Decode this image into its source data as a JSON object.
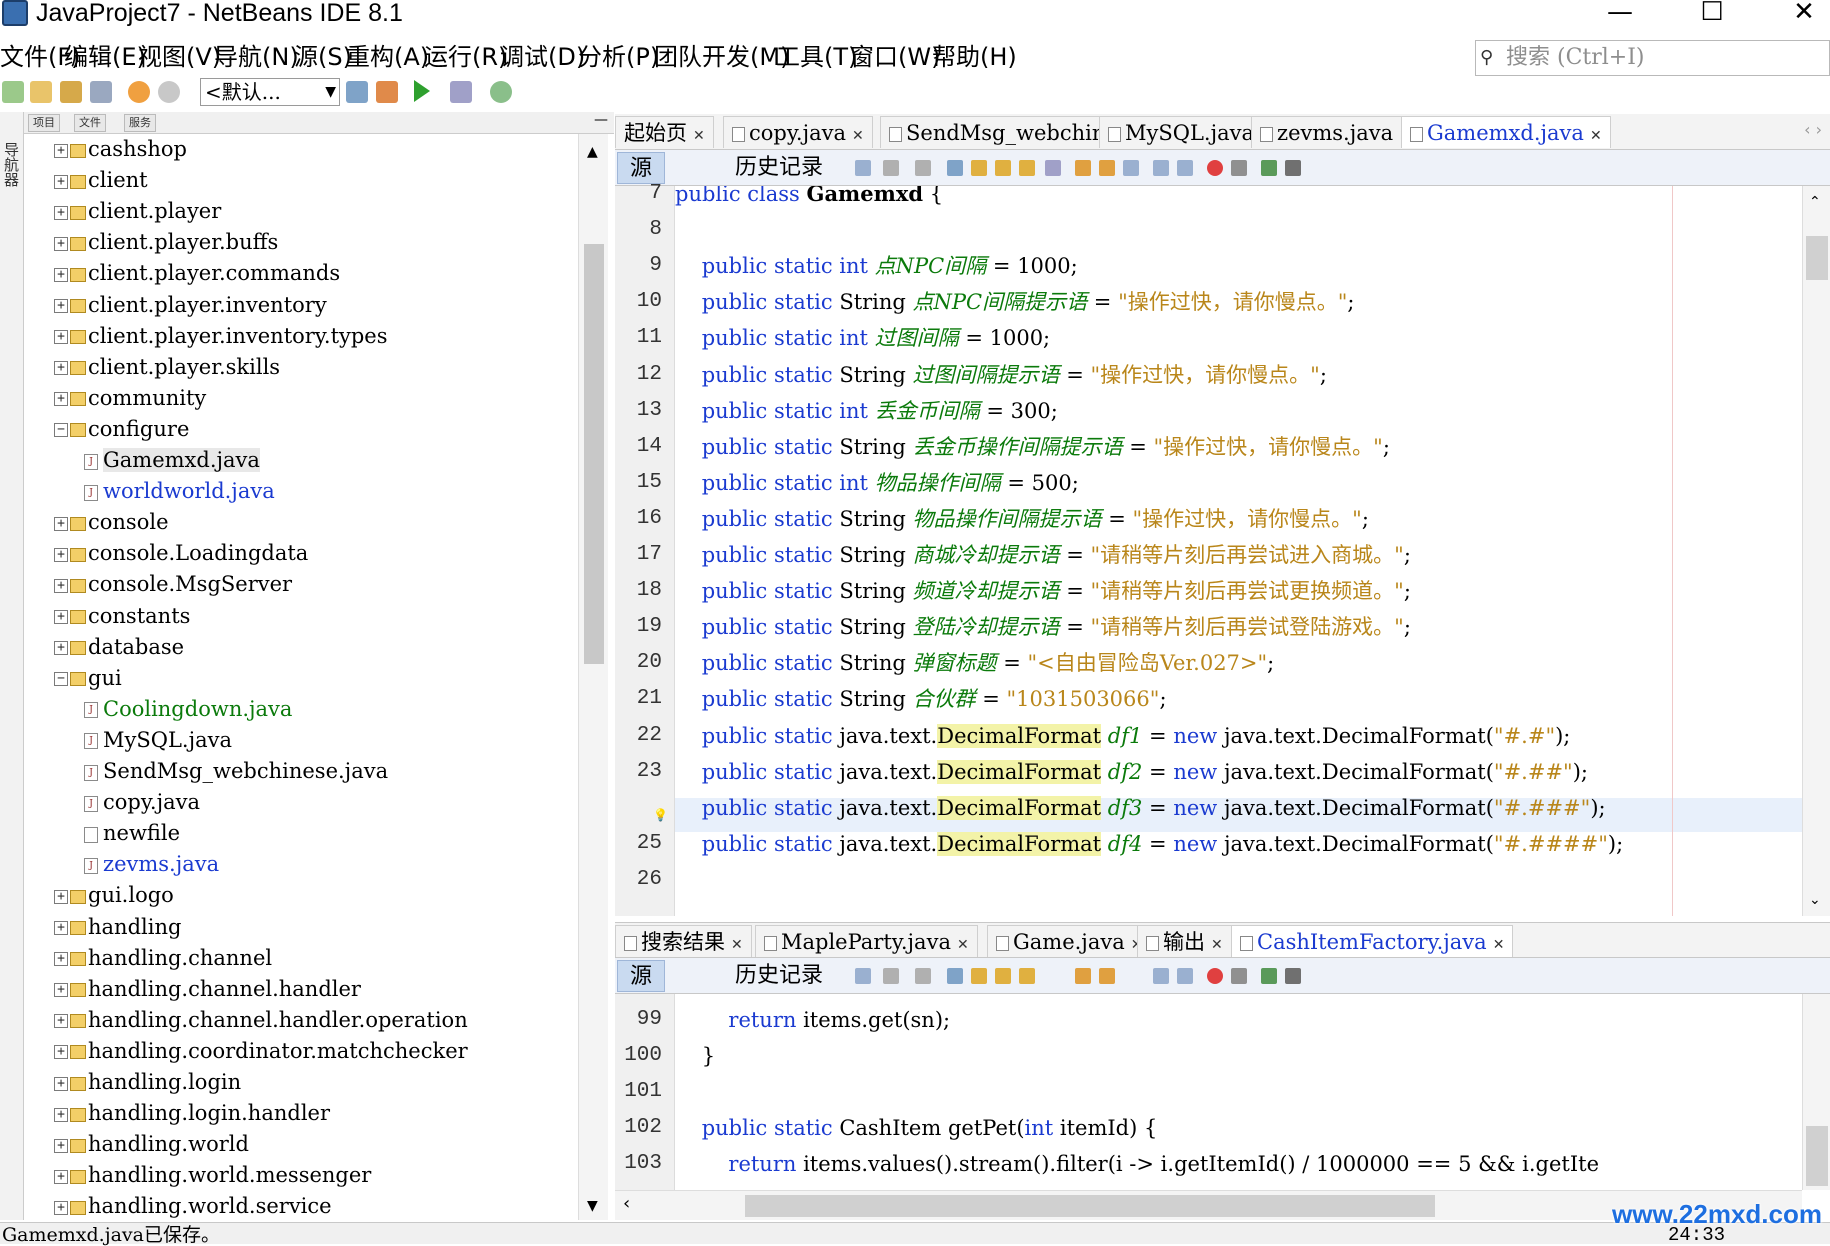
{
  "window": {
    "title": "JavaProject7 - NetBeans IDE 8.1",
    "min": "—",
    "max": "☐",
    "close": "✕"
  },
  "menu": [
    "文件(F)",
    "编辑(E)",
    "视图(V)",
    "导航(N)",
    "源(S)",
    "重构(A)",
    "运行(R)",
    "调试(D)",
    "分析(P)",
    "团队开发(M)",
    "工具(T)",
    "窗口(W)",
    "帮助(H)"
  ],
  "search": {
    "placeholder": "搜索 (Ctrl+I)"
  },
  "toolbar": {
    "config": "<默认..."
  },
  "side": {
    "navigator": "导航器"
  },
  "project_tabs": [
    "项目",
    "文件",
    "服务"
  ],
  "tree": [
    {
      "label": "cashshop",
      "type": "pkg",
      "exp": "+"
    },
    {
      "label": "client",
      "type": "pkg",
      "exp": "+"
    },
    {
      "label": "client.player",
      "type": "pkg",
      "exp": "+"
    },
    {
      "label": "client.player.buffs",
      "type": "pkg",
      "exp": "+"
    },
    {
      "label": "client.player.commands",
      "type": "pkg",
      "exp": "+"
    },
    {
      "label": "client.player.inventory",
      "type": "pkg",
      "exp": "+"
    },
    {
      "label": "client.player.inventory.types",
      "type": "pkg",
      "exp": "+"
    },
    {
      "label": "client.player.skills",
      "type": "pkg",
      "exp": "+"
    },
    {
      "label": "community",
      "type": "pkg",
      "exp": "+"
    },
    {
      "label": "configure",
      "type": "pkg",
      "exp": "−"
    },
    {
      "label": "Gamemxd.java",
      "type": "file",
      "sel": true
    },
    {
      "label": "worldworld.java",
      "type": "file",
      "color": "blue"
    },
    {
      "label": "console",
      "type": "pkg",
      "exp": "+"
    },
    {
      "label": "console.Loadingdata",
      "type": "pkg",
      "exp": "+"
    },
    {
      "label": "console.MsgServer",
      "type": "pkg",
      "exp": "+"
    },
    {
      "label": "constants",
      "type": "pkg",
      "exp": "+"
    },
    {
      "label": "database",
      "type": "pkg",
      "exp": "+"
    },
    {
      "label": "gui",
      "type": "pkg",
      "exp": "−"
    },
    {
      "label": "Coolingdown.java",
      "type": "file",
      "color": "green"
    },
    {
      "label": "MySQL.java",
      "type": "file"
    },
    {
      "label": "SendMsg_webchinese.java",
      "type": "file"
    },
    {
      "label": "copy.java",
      "type": "file"
    },
    {
      "label": "newfile",
      "type": "file"
    },
    {
      "label": "zevms.java",
      "type": "file",
      "color": "blue"
    },
    {
      "label": "gui.logo",
      "type": "pkg",
      "exp": "+"
    },
    {
      "label": "handling",
      "type": "pkg",
      "exp": "+"
    },
    {
      "label": "handling.channel",
      "type": "pkg",
      "exp": "+"
    },
    {
      "label": "handling.channel.handler",
      "type": "pkg",
      "exp": "+"
    },
    {
      "label": "handling.channel.handler.operation",
      "type": "pkg",
      "exp": "+"
    },
    {
      "label": "handling.coordinator.matchchecker",
      "type": "pkg",
      "exp": "+"
    },
    {
      "label": "handling.login",
      "type": "pkg",
      "exp": "+"
    },
    {
      "label": "handling.login.handler",
      "type": "pkg",
      "exp": "+"
    },
    {
      "label": "handling.world",
      "type": "pkg",
      "exp": "+"
    },
    {
      "label": "handling.world.messenger",
      "type": "pkg",
      "exp": "+"
    },
    {
      "label": "handling.world.service",
      "type": "pkg",
      "exp": "+"
    }
  ],
  "editor_tabs": [
    "起始页",
    "copy.java",
    "SendMsg_webchinese.java",
    "MySQL.java",
    "zevms.java",
    "Gamemxd.java"
  ],
  "source_btn": "源",
  "history_btn": "历史记录",
  "code_top": [
    {
      "n": "7",
      "parts": [
        [
          "kw",
          "public class "
        ],
        [
          "bold",
          "Gamemxd"
        ],
        [
          "",
          " {"
        ]
      ]
    },
    {
      "n": "8",
      "parts": []
    },
    {
      "n": "9",
      "parts": [
        [
          "kw",
          "    public static int "
        ],
        [
          "fld",
          "点NPC间隔"
        ],
        [
          "",
          " = 1000;"
        ]
      ]
    },
    {
      "n": "10",
      "parts": [
        [
          "kw",
          "    public static "
        ],
        [
          "",
          "String "
        ],
        [
          "fld",
          "点NPC间隔提示语"
        ],
        [
          "",
          " = "
        ],
        [
          "str",
          "\"操作过快，请你慢点。\""
        ],
        [
          "",
          ";"
        ]
      ]
    },
    {
      "n": "11",
      "parts": [
        [
          "kw",
          "    public static int "
        ],
        [
          "fld",
          "过图间隔"
        ],
        [
          "",
          " = 1000;"
        ]
      ]
    },
    {
      "n": "12",
      "parts": [
        [
          "kw",
          "    public static "
        ],
        [
          "",
          "String "
        ],
        [
          "fld",
          "过图间隔提示语"
        ],
        [
          "",
          " = "
        ],
        [
          "str",
          "\"操作过快，请你慢点。\""
        ],
        [
          "",
          ";"
        ]
      ]
    },
    {
      "n": "13",
      "parts": [
        [
          "kw",
          "    public static int "
        ],
        [
          "fld",
          "丢金币间隔"
        ],
        [
          "",
          " = 300;"
        ]
      ]
    },
    {
      "n": "14",
      "parts": [
        [
          "kw",
          "    public static "
        ],
        [
          "",
          "String "
        ],
        [
          "fld",
          "丢金币操作间隔提示语"
        ],
        [
          "",
          " = "
        ],
        [
          "str",
          "\"操作过快，请你慢点。\""
        ],
        [
          "",
          ";"
        ]
      ]
    },
    {
      "n": "15",
      "parts": [
        [
          "kw",
          "    public static int "
        ],
        [
          "fld",
          "物品操作间隔"
        ],
        [
          "",
          " = 500;"
        ]
      ]
    },
    {
      "n": "16",
      "parts": [
        [
          "kw",
          "    public static "
        ],
        [
          "",
          "String "
        ],
        [
          "fld",
          "物品操作间隔提示语"
        ],
        [
          "",
          " = "
        ],
        [
          "str",
          "\"操作过快，请你慢点。\""
        ],
        [
          "",
          ";"
        ]
      ]
    },
    {
      "n": "17",
      "parts": [
        [
          "kw",
          "    public static "
        ],
        [
          "",
          "String "
        ],
        [
          "fld",
          "商城冷却提示语"
        ],
        [
          "",
          " = "
        ],
        [
          "str",
          "\"请稍等片刻后再尝试进入商城。\""
        ],
        [
          "",
          ";"
        ]
      ]
    },
    {
      "n": "18",
      "parts": [
        [
          "kw",
          "    public static "
        ],
        [
          "",
          "String "
        ],
        [
          "fld",
          "频道冷却提示语"
        ],
        [
          "",
          " = "
        ],
        [
          "str",
          "\"请稍等片刻后再尝试更换频道。\""
        ],
        [
          "",
          ";"
        ]
      ]
    },
    {
      "n": "19",
      "parts": [
        [
          "kw",
          "    public static "
        ],
        [
          "",
          "String "
        ],
        [
          "fld",
          "登陆冷却提示语"
        ],
        [
          "",
          " = "
        ],
        [
          "str",
          "\"请稍等片刻后再尝试登陆游戏。\""
        ],
        [
          "",
          ";"
        ]
      ]
    },
    {
      "n": "20",
      "parts": [
        [
          "kw",
          "    public static "
        ],
        [
          "",
          "String "
        ],
        [
          "fld",
          "弹窗标题"
        ],
        [
          "",
          " = "
        ],
        [
          "str",
          "\"<自由冒险岛Ver.027>\""
        ],
        [
          "",
          ";"
        ]
      ]
    },
    {
      "n": "21",
      "parts": [
        [
          "kw",
          "    public static "
        ],
        [
          "",
          "String "
        ],
        [
          "fld",
          "合伙群"
        ],
        [
          "",
          " = "
        ],
        [
          "str",
          "\"1031503066\""
        ],
        [
          "",
          ";"
        ]
      ]
    },
    {
      "n": "22",
      "parts": [
        [
          "kw",
          "    public static "
        ],
        [
          "",
          "java.text."
        ],
        [
          "hl",
          "DecimalFormat"
        ],
        [
          "",
          " "
        ],
        [
          "fld",
          "df1"
        ],
        [
          "",
          " = "
        ],
        [
          "kw",
          "new "
        ],
        [
          "",
          "java.text.DecimalFormat("
        ],
        [
          "str",
          "\"#.#\""
        ],
        [
          "",
          ");"
        ]
      ]
    },
    {
      "n": "23",
      "parts": [
        [
          "kw",
          "    public static "
        ],
        [
          "",
          "java.text."
        ],
        [
          "hl",
          "DecimalFormat"
        ],
        [
          "",
          " "
        ],
        [
          "fld",
          "df2"
        ],
        [
          "",
          " = "
        ],
        [
          "kw",
          "new "
        ],
        [
          "",
          "java.text.DecimalFormat("
        ],
        [
          "str",
          "\"#.##\""
        ],
        [
          "",
          ");"
        ]
      ]
    },
    {
      "n": "",
      "parts": [
        [
          "kw",
          "    public static "
        ],
        [
          "",
          "java.text."
        ],
        [
          "hl",
          "DecimalFormat"
        ],
        [
          "",
          " "
        ],
        [
          "fld",
          "df3"
        ],
        [
          "",
          " = "
        ],
        [
          "kw",
          "new "
        ],
        [
          "",
          "java.text.DecimalFormat("
        ],
        [
          "str",
          "\"#.###\""
        ],
        [
          "",
          ");"
        ]
      ]
    },
    {
      "n": "25",
      "parts": [
        [
          "kw",
          "    public static "
        ],
        [
          "",
          "java.text."
        ],
        [
          "hl",
          "DecimalFormat"
        ],
        [
          "",
          " "
        ],
        [
          "fld",
          "df4"
        ],
        [
          "",
          " = "
        ],
        [
          "kw",
          "new "
        ],
        [
          "",
          "java.text.DecimalFormat("
        ],
        [
          "str",
          "\"#.####\""
        ],
        [
          "",
          ");"
        ]
      ]
    },
    {
      "n": "26",
      "parts": []
    }
  ],
  "bottom_tabs": [
    "搜索结果",
    "MapleParty.java",
    "Game.java",
    "输出",
    "CashItemFactory.java"
  ],
  "code_bottom": [
    {
      "n": "99",
      "parts": [
        [
          "kw",
          "        return "
        ],
        [
          "",
          "items.get(sn);"
        ]
      ]
    },
    {
      "n": "100",
      "parts": [
        [
          "",
          "    }"
        ]
      ]
    },
    {
      "n": "101",
      "parts": []
    },
    {
      "n": "102",
      "parts": [
        [
          "kw",
          "    public static "
        ],
        [
          "",
          "CashItem getPet("
        ],
        [
          "kw",
          "int "
        ],
        [
          "",
          "itemId) {"
        ]
      ]
    },
    {
      "n": "103",
      "parts": [
        [
          "kw",
          "        return "
        ],
        [
          "",
          "items.values().stream().filter(i -> i.getItemId() / 1000000 == 5 && i.getIte"
        ]
      ]
    }
  ],
  "status": {
    "message": "Gamemxd.java已保存。",
    "position": "24:33"
  },
  "watermark": "www.22mxd.com"
}
